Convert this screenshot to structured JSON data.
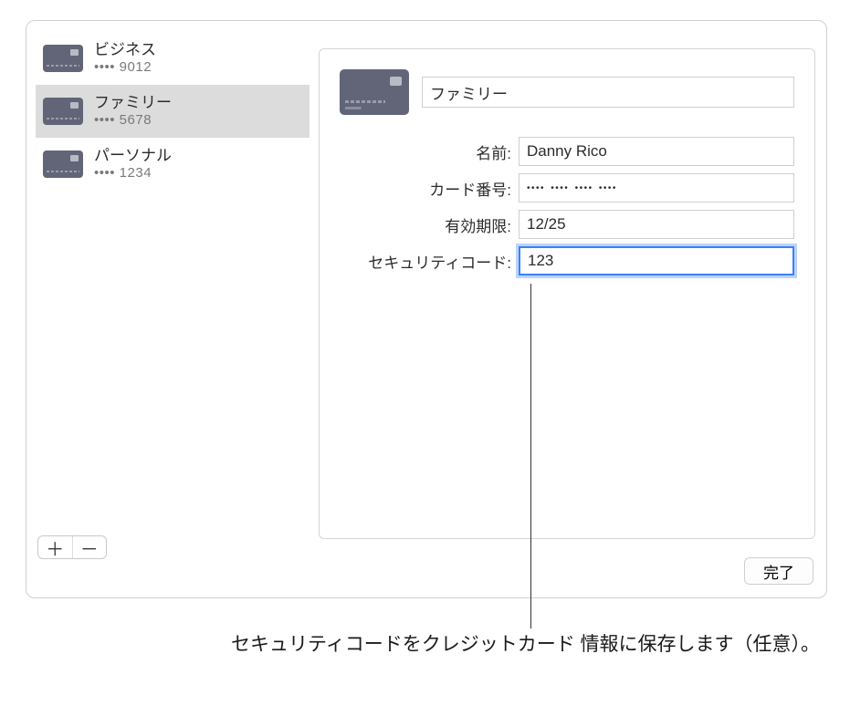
{
  "sidebar": {
    "cards": [
      {
        "title": "ビジネス",
        "subtitle": "•••• 9012"
      },
      {
        "title": "ファミリー",
        "subtitle": "•••• 5678"
      },
      {
        "title": "パーソナル",
        "subtitle": "•••• 1234"
      }
    ],
    "selected_index": 1,
    "add_label": "＋",
    "remove_label": "－"
  },
  "detail": {
    "title_value": "ファミリー",
    "fields": {
      "name": {
        "label": "名前:",
        "value": "Danny Rico"
      },
      "number": {
        "label": "カード番号:",
        "value": "•••• •••• •••• ••••"
      },
      "expiry": {
        "label": "有効期限:",
        "value": "12/25"
      },
      "security": {
        "label": "セキュリティコード:",
        "value": "123"
      }
    }
  },
  "done_button": "完了",
  "callout": "セキュリティコードをクレジットカード\n情報に保存します（任意）。"
}
